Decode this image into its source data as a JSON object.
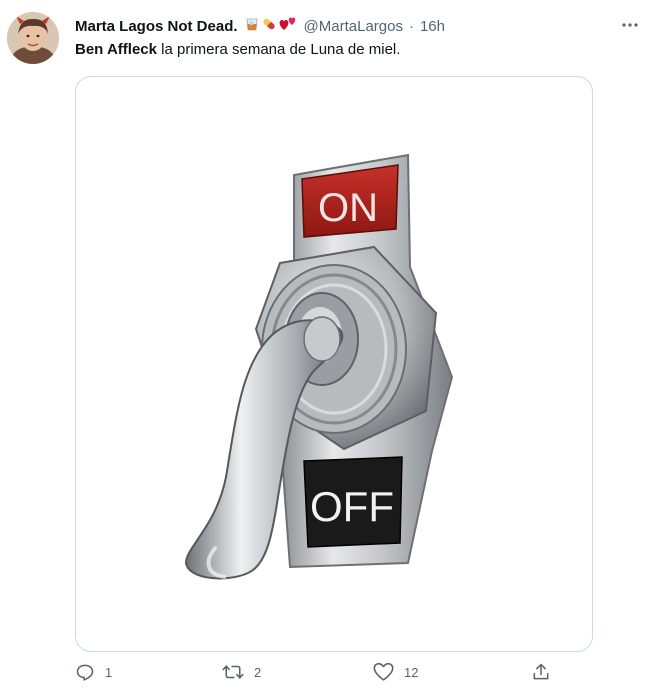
{
  "tweet": {
    "display_name": "Marta Lagos Not Dead.",
    "handle": "@MartaLargos",
    "separator": "·",
    "time": "16h",
    "emoji_icons": [
      "tumbler-glass-icon",
      "pill-icon",
      "two-hearts-icon"
    ],
    "text_mention": "Ben Affleck",
    "text_body": " la primera semana de Luna de miel.",
    "image": {
      "on_label": "ON",
      "off_label": "OFF"
    }
  },
  "actions": {
    "reply_count": "1",
    "retweet_count": "2",
    "like_count": "12"
  },
  "colors": {
    "secondary_text": "#536471",
    "border": "#cfd9de",
    "on_plate": "#b1231b",
    "off_plate": "#1a1a1a"
  }
}
